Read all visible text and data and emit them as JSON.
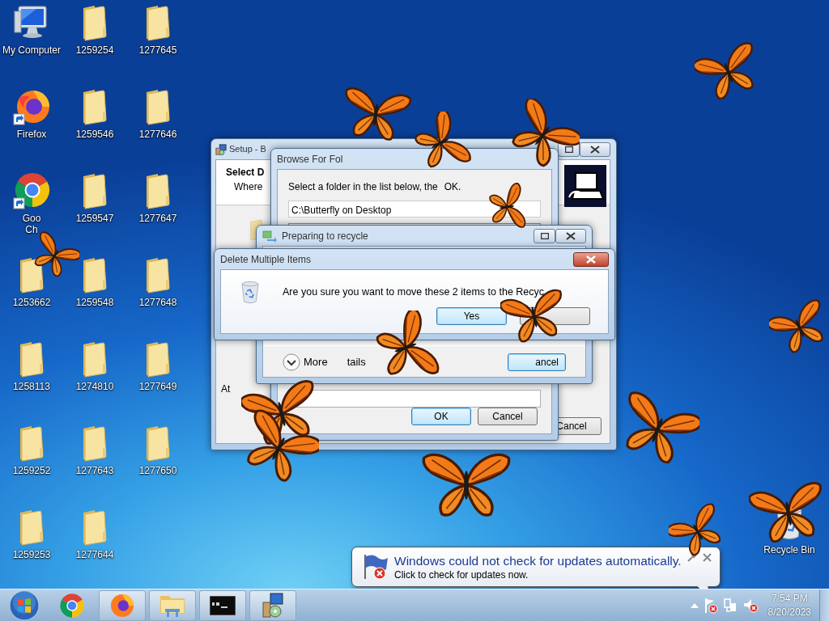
{
  "desktop_icons": [
    {
      "kind": "computer",
      "label": "My Computer"
    },
    {
      "kind": "firefox",
      "label": "Firefox"
    },
    {
      "kind": "chrome",
      "label": "Goo\nCh"
    },
    {
      "kind": "folder",
      "label": "1253662"
    },
    {
      "kind": "folder",
      "label": "1258113"
    },
    {
      "kind": "folder",
      "label": "1259252"
    },
    {
      "kind": "folder",
      "label": "1259253"
    },
    {
      "kind": "folder",
      "label": "1259254"
    },
    {
      "kind": "folder",
      "label": "1259546"
    },
    {
      "kind": "folder",
      "label": "1259547"
    },
    {
      "kind": "folder",
      "label": "1259548"
    },
    {
      "kind": "folder",
      "label": "1274810"
    },
    {
      "kind": "folder",
      "label": "1277643"
    },
    {
      "kind": "folder",
      "label": "1277644"
    },
    {
      "kind": "folder",
      "label": "1277645"
    },
    {
      "kind": "folder",
      "label": "1277646"
    },
    {
      "kind": "folder",
      "label": "1277647"
    },
    {
      "kind": "folder",
      "label": "1277648"
    },
    {
      "kind": "folder",
      "label": "1277649"
    },
    {
      "kind": "folder",
      "label": "1277650"
    }
  ],
  "recycle_bin": {
    "label": "Recycle Bin"
  },
  "setup_window": {
    "title": "Setup - B",
    "heading": "Select D",
    "subheading": "Where",
    "field_label": "At",
    "cancel_button": "Cancel"
  },
  "browse_dialog": {
    "title": "Browse For Fol",
    "instruction": "Select a folder in the list below, the",
    "instruction_end": "OK.",
    "path": "C:\\Butterfly on Desktop",
    "ok_button": "OK",
    "cancel_button": "Cancel"
  },
  "recycle_progress": {
    "title": "Preparing to recycle",
    "details_start": "More",
    "details_end": "tails",
    "cancel_button": "ancel"
  },
  "delete_dialog": {
    "title": "Delete Multiple Items",
    "message": "Are you sure you want to move these 2 items to the Recyc",
    "buttons": [
      {
        "kind": "default",
        "label": "Yes"
      },
      {
        "kind": "normal"
      }
    ]
  },
  "notification": {
    "title": "Windows could not check for updates automatically.",
    "body": "Click to check for updates now."
  },
  "taskbar": {
    "apps": [
      {
        "kind": "chrome",
        "open": false
      },
      {
        "kind": "firefox",
        "open": true
      },
      {
        "kind": "explorer",
        "open": true
      },
      {
        "kind": "terminal",
        "open": true
      },
      {
        "kind": "installer",
        "open": true
      }
    ],
    "time": "7:54 PM",
    "date": "8/20/2023"
  }
}
